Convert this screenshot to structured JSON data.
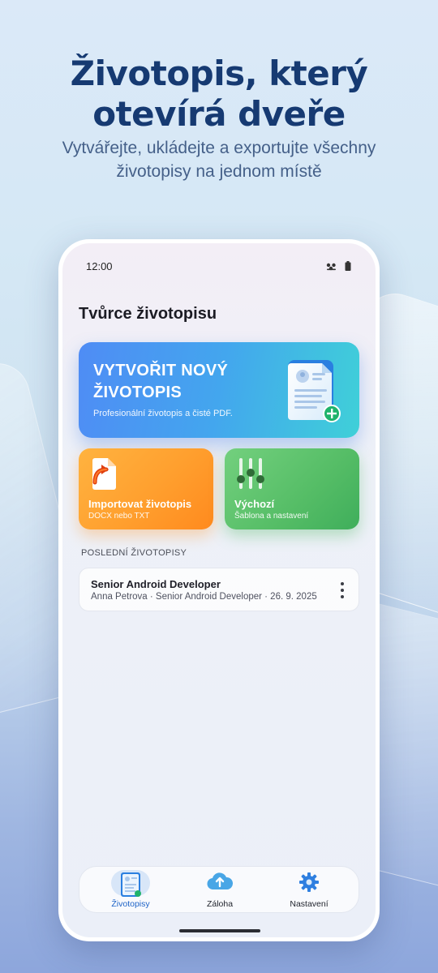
{
  "marketing": {
    "headline": "Životopis, který otevírá dveře",
    "subline": "Vytvářejte, ukládejte a exportujte všechny životopisy na jednom místě"
  },
  "status_bar": {
    "time": "12:00",
    "icons": [
      "signal-icon",
      "battery-icon"
    ]
  },
  "app": {
    "title": "Tvůrce životopisu"
  },
  "hero_card": {
    "title": "VYTVOŘIT NOVÝ ŽIVOTOPIS",
    "subtitle": "Profesionální životopis a čisté PDF.",
    "icon": "new-resume-icon"
  },
  "tiles": {
    "import": {
      "title": "Importovat životopis",
      "subtitle": "DOCX nebo TXT",
      "icon": "import-document-icon"
    },
    "default": {
      "title": "Výchozí",
      "subtitle": "Šablona a nastavení",
      "icon": "sliders-icon"
    }
  },
  "recent": {
    "section_label": "POSLEDNÍ ŽIVOTOPISY",
    "items": [
      {
        "title": "Senior Android Developer",
        "meta": "Anna Petrova · Senior Android Developer · 26. 9. 2025"
      }
    ]
  },
  "bottom_nav": {
    "items": [
      {
        "label": "Životopisy",
        "icon": "resumes-icon",
        "active": true
      },
      {
        "label": "Záloha",
        "icon": "cloud-upload-icon",
        "active": false
      },
      {
        "label": "Nastavení",
        "icon": "gear-icon",
        "active": false
      }
    ]
  },
  "colors": {
    "headline": "#163a72",
    "hero_start": "#4f8cf5",
    "hero_end": "#3fd0d8",
    "import_tile": "#ff9f2e",
    "default_tile": "#55bd66",
    "nav_active": "#1e63c7"
  }
}
